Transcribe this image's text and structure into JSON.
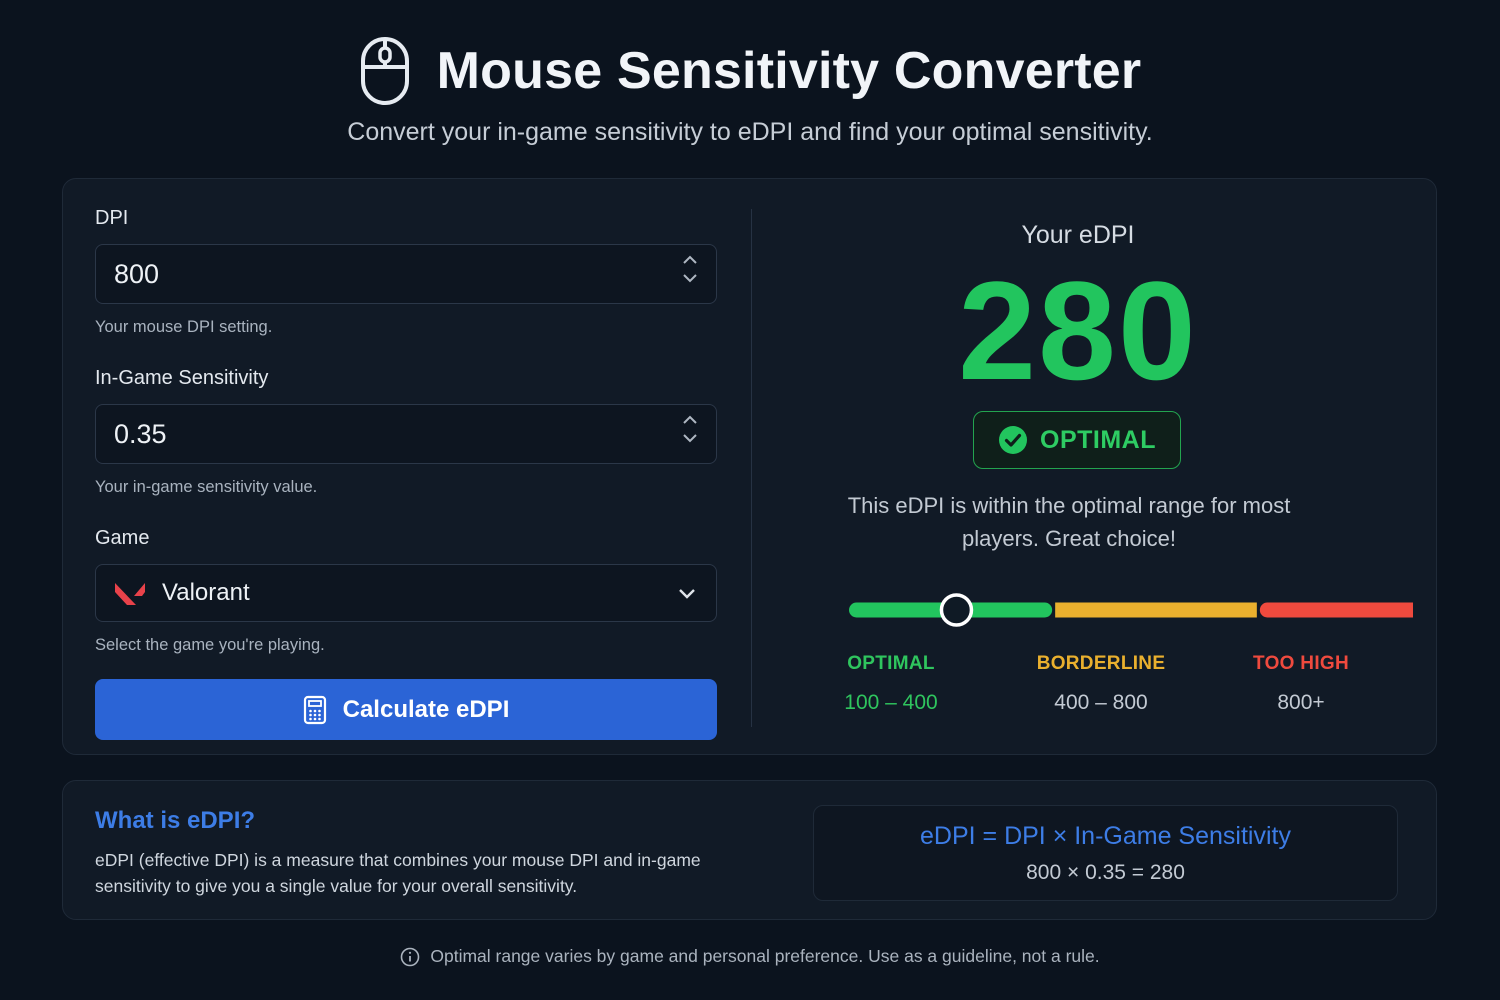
{
  "header": {
    "title": "Mouse Sensitivity Converter",
    "subtitle": "Convert your in-game sensitivity to eDPI and find your optimal sensitivity.",
    "icon": "mouse-icon"
  },
  "form": {
    "dpi": {
      "label": "DPI",
      "value": "800",
      "help": "Your mouse DPI setting."
    },
    "sensitivity": {
      "label": "In-Game Sensitivity",
      "value": "0.35",
      "help": "Your in-game sensitivity value."
    },
    "game": {
      "label": "Game",
      "selected": "Valorant",
      "help": "Select the game you're playing.",
      "icon": "valorant-logo-icon"
    },
    "calculate_label": "Calculate eDPI"
  },
  "result": {
    "label": "Your eDPI",
    "value": "280",
    "badge": "OPTIMAL",
    "description": "This eDPI is within the optimal range for most players. Great choice!",
    "indicator_fraction": 0.175,
    "ranges": [
      {
        "name": "OPTIMAL",
        "range": "100 – 400",
        "color": "#22c55e"
      },
      {
        "name": "BORDERLINE",
        "range": "400 – 800",
        "color": "#eab02e"
      },
      {
        "name": "TOO HIGH",
        "range": "800+",
        "color": "#ef4a3e"
      }
    ]
  },
  "info": {
    "title": "What is eDPI?",
    "text": "eDPI (effective DPI) is a measure that combines your mouse DPI and in-game sensitivity to give you a single value for your overall sensitivity.",
    "formula": "eDPI = DPI × In-Game Sensitivity",
    "example": "800 × 0.35 = 280"
  },
  "footer": {
    "note": "Optimal range varies by game and personal preference. Use as a guideline, not a rule."
  },
  "colors": {
    "accent": "#2b64d6",
    "optimal": "#22c55e",
    "borderline": "#eab02e",
    "high": "#ef4a3e",
    "background": "#0b131e"
  }
}
